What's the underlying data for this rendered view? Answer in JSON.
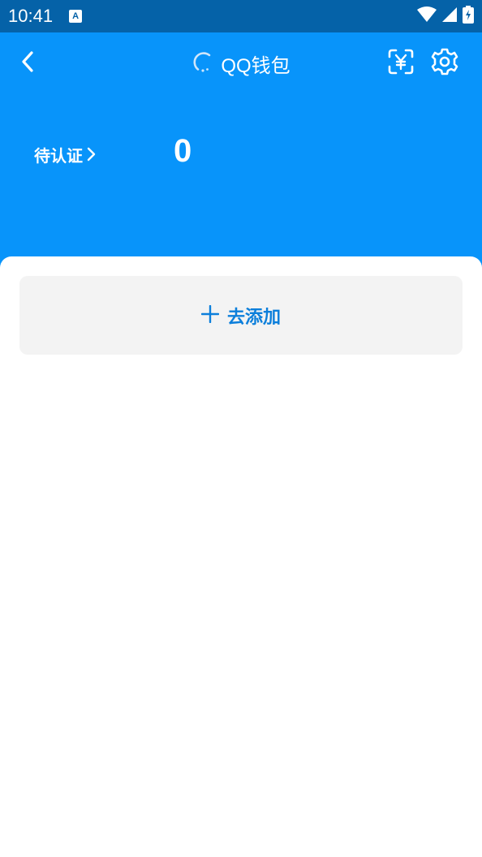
{
  "status_bar": {
    "time": "10:41",
    "app_icon_letter": "A",
    "icons": [
      "wifi-icon",
      "signal-icon",
      "battery-icon"
    ]
  },
  "header": {
    "back_icon": "chevron-left-icon",
    "loading_icon": "loading-spinner-icon",
    "title": "QQ钱包",
    "scan_icon": "yuan-scan-icon",
    "settings_icon": "gear-icon"
  },
  "summary": {
    "pending_label": "待认证",
    "count": "0"
  },
  "add_card": {
    "label": "去添加",
    "icon": "plus-icon"
  },
  "colors": {
    "status_bar": "#0562A8",
    "header_bg": "#0894FA",
    "card_bg": "#F3F3F3",
    "accent": "#0C7FDB"
  }
}
